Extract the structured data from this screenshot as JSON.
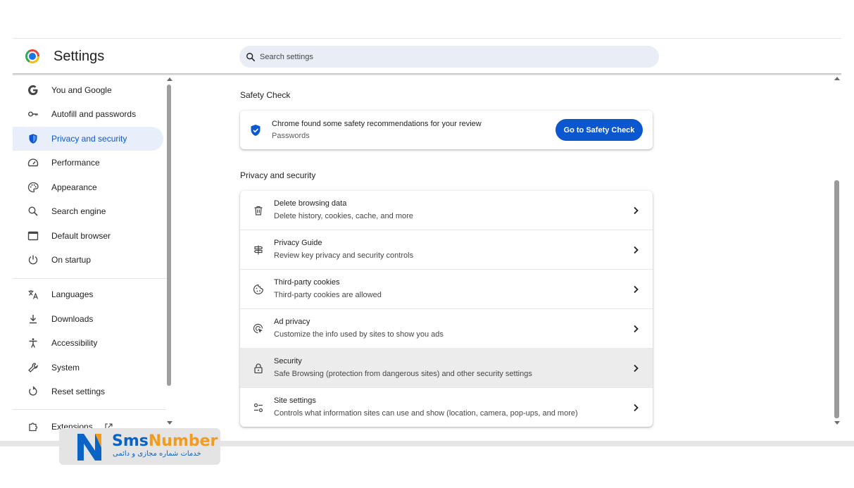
{
  "app": {
    "title": "Settings"
  },
  "search": {
    "placeholder": "Search settings"
  },
  "sidebar": {
    "items": [
      {
        "label": "You and Google",
        "icon": "google-icon"
      },
      {
        "label": "Autofill and passwords",
        "icon": "key-icon"
      },
      {
        "label": "Privacy and security",
        "icon": "shield-icon",
        "active": true
      },
      {
        "label": "Performance",
        "icon": "speedometer-icon"
      },
      {
        "label": "Appearance",
        "icon": "palette-icon"
      },
      {
        "label": "Search engine",
        "icon": "search-icon"
      },
      {
        "label": "Default browser",
        "icon": "browser-window-icon"
      },
      {
        "label": "On startup",
        "icon": "power-icon"
      },
      {
        "label": "Languages",
        "icon": "translate-icon"
      },
      {
        "label": "Downloads",
        "icon": "download-icon"
      },
      {
        "label": "Accessibility",
        "icon": "accessibility-icon"
      },
      {
        "label": "System",
        "icon": "wrench-icon"
      },
      {
        "label": "Reset settings",
        "icon": "reset-icon"
      },
      {
        "label": "Extensions",
        "icon": "puzzle-icon"
      }
    ]
  },
  "safety_check": {
    "heading": "Safety Check",
    "title": "Chrome found some safety recommendations for your review",
    "subtitle": "Passwords",
    "button": "Go to Safety Check"
  },
  "privacy": {
    "heading": "Privacy and security",
    "rows": [
      {
        "title": "Delete browsing data",
        "subtitle": "Delete history, cookies, cache, and more",
        "icon": "trash-icon"
      },
      {
        "title": "Privacy Guide",
        "subtitle": "Review key privacy and security controls",
        "icon": "signpost-icon"
      },
      {
        "title": "Third-party cookies",
        "subtitle": "Third-party cookies are allowed",
        "icon": "cookie-icon"
      },
      {
        "title": "Ad privacy",
        "subtitle": "Customize the info used by sites to show you ads",
        "icon": "ad-privacy-icon"
      },
      {
        "title": "Security",
        "subtitle": "Safe Browsing (protection from dangerous sites) and other security settings",
        "icon": "lock-icon"
      },
      {
        "title": "Site settings",
        "subtitle": "Controls what information sites can use and show (location, camera, pop-ups, and more)",
        "icon": "tune-icon"
      }
    ]
  },
  "watermark": {
    "brand_a": "Sms",
    "brand_b": "Number",
    "tagline": "خدمات شماره مجازی و دائمی"
  },
  "colors": {
    "accent": "#0b57d0",
    "active_nav_bg": "#e8eefa",
    "search_bg": "#e9eef6"
  }
}
